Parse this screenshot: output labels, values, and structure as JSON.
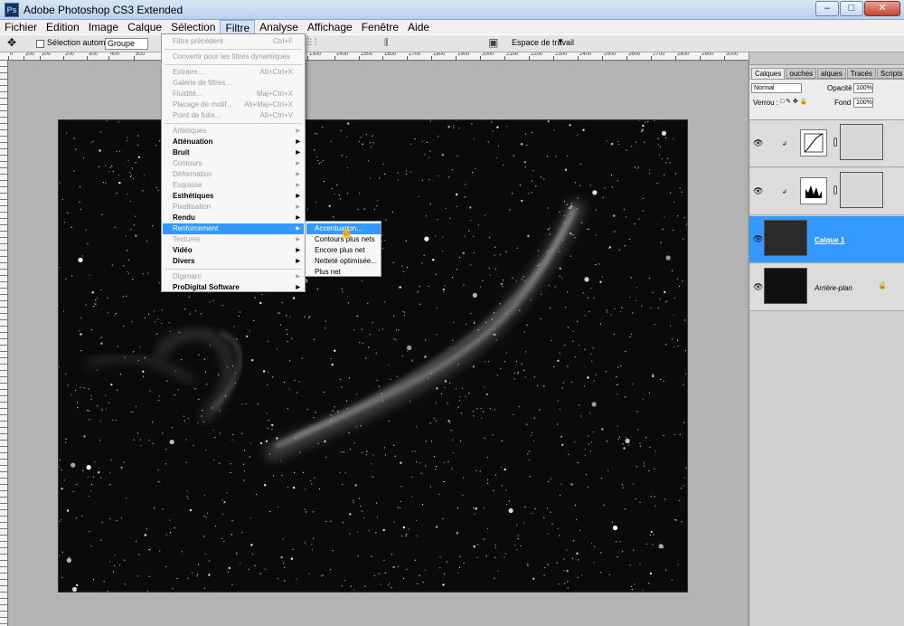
{
  "window": {
    "title": "Adobe Photoshop CS3 Extended",
    "app_icon": "Ps",
    "btn_min": "–",
    "btn_max": "□",
    "btn_close": "✕"
  },
  "menubar": [
    "Fichier",
    "Edition",
    "Image",
    "Calque",
    "Sélection",
    "Filtre",
    "Analyse",
    "Affichage",
    "Fenêtre",
    "Aide"
  ],
  "options": {
    "auto_select_label": "Sélection automatique :",
    "auto_select_value": "Groupe",
    "workspace_label": "Espace de travail"
  },
  "ruler_ticks": [
    "0",
    "200",
    "100",
    "200",
    "300",
    "400",
    "500",
    "1300",
    "1400",
    "1500",
    "1600",
    "1700",
    "1800",
    "1900",
    "2000",
    "2100",
    "2200",
    "2300",
    "2400",
    "2500",
    "2600",
    "2700",
    "2800",
    "2900",
    "3000",
    "3100",
    "3200",
    "3300",
    "3400",
    "3500"
  ],
  "filter_menu": {
    "items": [
      {
        "label": "Filtre précédent",
        "shortcut": "Ctrl+F",
        "style": "dis"
      },
      {
        "label": "Convertir pour les filtres dynamiques",
        "shortcut": "",
        "style": "dis"
      },
      {
        "label": "Extraire...",
        "shortcut": "Alt+Ctrl+X",
        "style": "dis"
      },
      {
        "label": "Galerie de filtres...",
        "shortcut": "",
        "style": "dis"
      },
      {
        "label": "Fluidité...",
        "shortcut": "Maj+Ctrl+X",
        "style": "dis"
      },
      {
        "label": "Placage de motif...",
        "shortcut": "Alt+Maj+Ctrl+X",
        "style": "dis"
      },
      {
        "label": "Point de fuite...",
        "shortcut": "Alt+Ctrl+V",
        "style": "dis"
      },
      {
        "label": "Artistiques",
        "shortcut": "",
        "style": "dis",
        "sub": true
      },
      {
        "label": "Atténuation",
        "shortcut": "",
        "style": "bold",
        "sub": true
      },
      {
        "label": "Bruit",
        "shortcut": "",
        "style": "bold",
        "sub": true
      },
      {
        "label": "Contours",
        "shortcut": "",
        "style": "dis",
        "sub": true
      },
      {
        "label": "Déformation",
        "shortcut": "",
        "style": "dis",
        "sub": true
      },
      {
        "label": "Esquisse",
        "shortcut": "",
        "style": "dis",
        "sub": true
      },
      {
        "label": "Esthétiques",
        "shortcut": "",
        "style": "bold",
        "sub": true
      },
      {
        "label": "Pixellisation",
        "shortcut": "",
        "style": "dis",
        "sub": true
      },
      {
        "label": "Rendu",
        "shortcut": "",
        "style": "bold",
        "sub": true
      },
      {
        "label": "Renforcement",
        "shortcut": "",
        "style": "hl",
        "sub": true
      },
      {
        "label": "Textures",
        "shortcut": "",
        "style": "dis",
        "sub": true
      },
      {
        "label": "Vidéo",
        "shortcut": "",
        "style": "bold",
        "sub": true
      },
      {
        "label": "Divers",
        "shortcut": "",
        "style": "bold",
        "sub": true
      },
      {
        "label": "Digimarc",
        "shortcut": "",
        "style": "dis",
        "sub": true
      },
      {
        "label": "ProDigital Software",
        "shortcut": "",
        "style": "bold",
        "sub": true
      }
    ],
    "arrow": "▶"
  },
  "submenu": [
    "Accentuation...",
    "Contours plus nets",
    "Encore plus net",
    "Netteté optimisée...",
    "Plus net"
  ],
  "panel": {
    "tabs": [
      "Calques ×",
      "ouches",
      "alques",
      "Tracés",
      "Scripts"
    ],
    "blend_mode": "Normal",
    "opacity_label": "Opacité :",
    "opacity_value": "100%",
    "lock_label": "Verrou :",
    "fill_label": "Fond :",
    "fill_value": "100%",
    "layers": [
      {
        "name": "",
        "type": "adjustment-curves"
      },
      {
        "name": "",
        "type": "adjustment-levels"
      },
      {
        "name": "Calque 1",
        "type": "pixel"
      },
      {
        "name": "Arrière-plan",
        "type": "background"
      }
    ]
  },
  "accent_color": "#3399ff"
}
